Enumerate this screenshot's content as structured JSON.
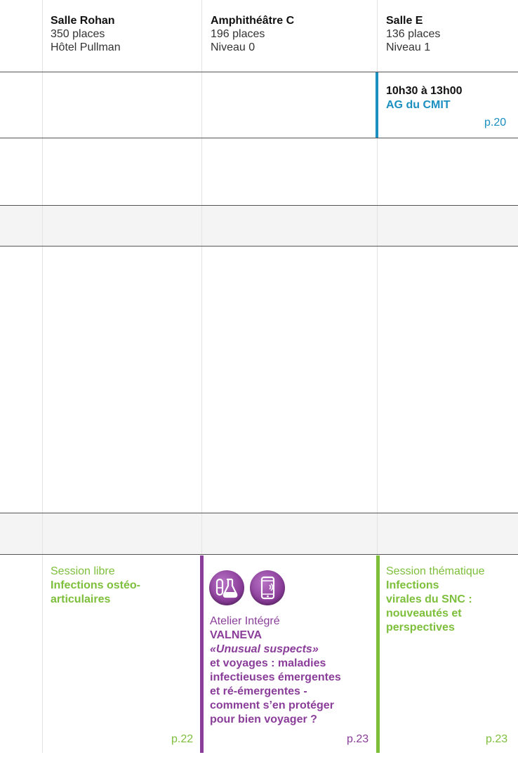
{
  "columns": [
    {
      "name": "Salle Rohan",
      "capacity": "350 places",
      "location": "Hôtel Pullman"
    },
    {
      "name": "Amphithéâtre C",
      "capacity": "196 places",
      "location": "Niveau 0"
    },
    {
      "name": "Salle E",
      "capacity": "136 places",
      "location": "Niveau 1"
    }
  ],
  "ag_session": {
    "time": "10h30 à 13h00",
    "title": "AG du CMIT",
    "page": "p.20"
  },
  "session_libre": {
    "kind": "Session libre",
    "title_line1": "Infections ostéo-",
    "title_line2": "articulaires",
    "page": "p.22"
  },
  "atelier": {
    "kind": "Atelier Intégré",
    "sponsor": "VALNEVA",
    "italic_title": "«Unusual suspects»",
    "title_lines": [
      "et voyages : maladies",
      "infectieuses émergentes",
      "et ré-émergentes  -",
      "comment s’en protéger",
      "pour bien voyager ?"
    ],
    "page": "p.23",
    "icons": [
      "lab-flask-icon",
      "smartphone-icon"
    ]
  },
  "session_thematique": {
    "kind": "Session thématique",
    "title_lines": [
      "Infections",
      "virales du SNC :",
      "nouveautés et",
      "perspectives"
    ],
    "page": "p.23"
  },
  "colors": {
    "green": "#7dbf3b",
    "purple": "#8a3d99",
    "blue": "#1a8fc0"
  }
}
